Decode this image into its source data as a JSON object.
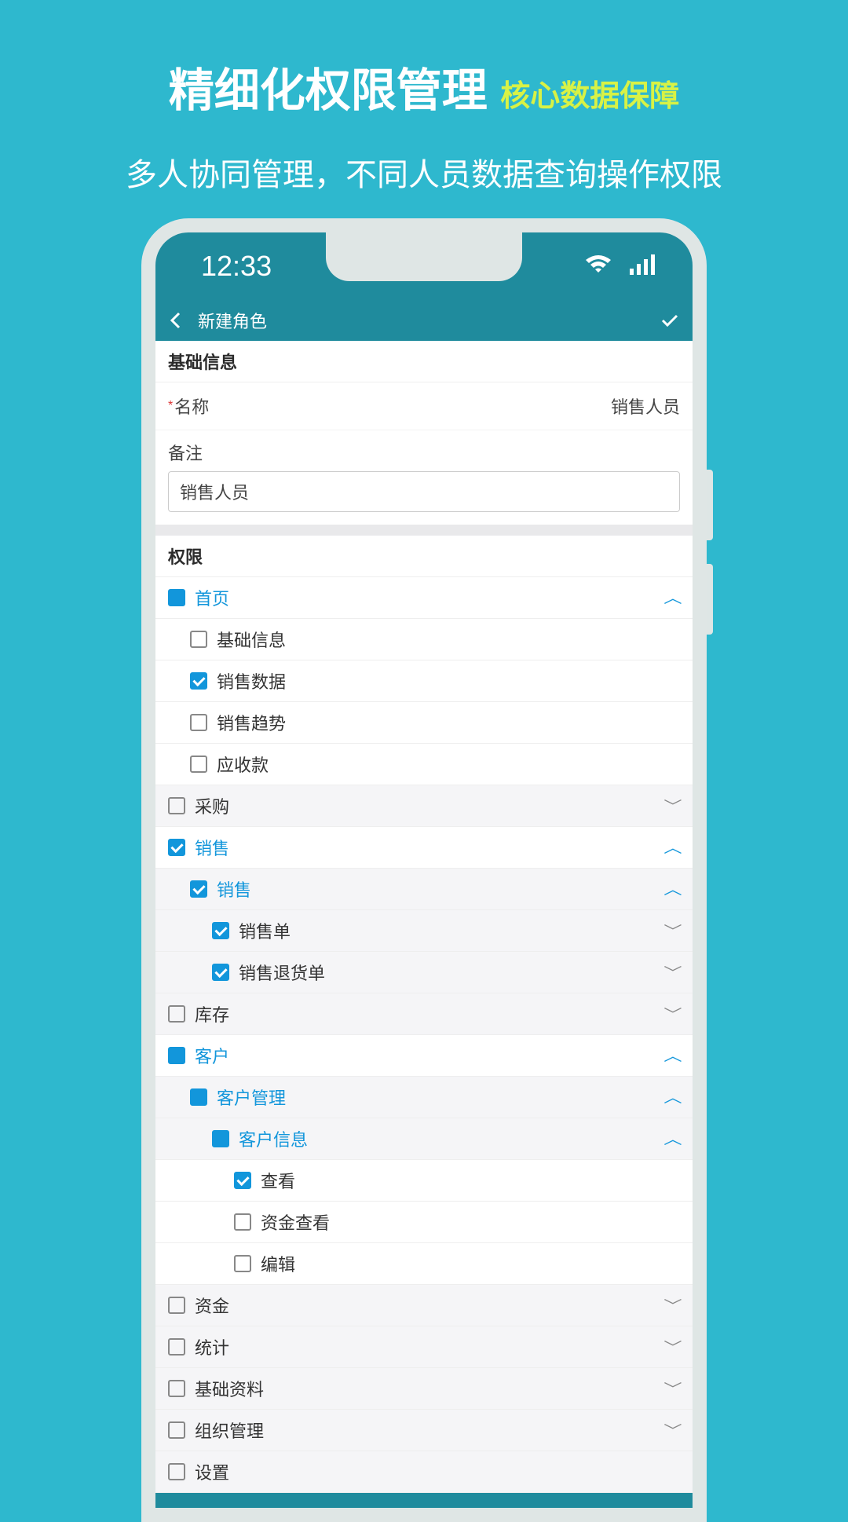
{
  "promo": {
    "title": "精细化权限管理",
    "subtitle": "核心数据保障",
    "description": "多人协同管理，不同人员数据查询操作权限"
  },
  "status": {
    "time": "12:33"
  },
  "nav": {
    "title": "新建角色"
  },
  "sections": {
    "basic": "基础信息",
    "permission": "权限"
  },
  "form": {
    "name_label": "名称",
    "name_value": "销售人员",
    "remark_label": "备注",
    "remark_value": "销售人员"
  },
  "permissions": [
    {
      "label": "首页",
      "state": "partial",
      "blue": true,
      "indent": 0,
      "expand": "up",
      "expandBlue": true
    },
    {
      "label": "基础信息",
      "state": "unchecked",
      "indent": 1
    },
    {
      "label": "销售数据",
      "state": "checked",
      "indent": 1
    },
    {
      "label": "销售趋势",
      "state": "unchecked",
      "indent": 1
    },
    {
      "label": "应收款",
      "state": "unchecked",
      "indent": 1
    },
    {
      "label": "采购",
      "state": "unchecked",
      "indent": 0,
      "expand": "down",
      "sub": true
    },
    {
      "label": "销售",
      "state": "checked",
      "blue": true,
      "indent": 0,
      "expand": "up",
      "expandBlue": true
    },
    {
      "label": "销售",
      "state": "checked",
      "blue": true,
      "indent": 1,
      "expand": "up",
      "expandBlue": true,
      "sub": true
    },
    {
      "label": "销售单",
      "state": "checked",
      "indent": 2,
      "expand": "down",
      "sub": true
    },
    {
      "label": "销售退货单",
      "state": "checked",
      "indent": 2,
      "expand": "down",
      "sub": true
    },
    {
      "label": "库存",
      "state": "unchecked",
      "indent": 0,
      "expand": "down",
      "sub": true
    },
    {
      "label": "客户",
      "state": "partial",
      "blue": true,
      "indent": 0,
      "expand": "up",
      "expandBlue": true
    },
    {
      "label": "客户管理",
      "state": "partial",
      "blue": true,
      "indent": 1,
      "expand": "up",
      "expandBlue": true,
      "sub": true
    },
    {
      "label": "客户信息",
      "state": "partial",
      "blue": true,
      "indent": 2,
      "expand": "up",
      "expandBlue": true,
      "sub": true
    },
    {
      "label": "查看",
      "state": "checked",
      "indent": 3
    },
    {
      "label": "资金查看",
      "state": "unchecked",
      "indent": 3
    },
    {
      "label": "编辑",
      "state": "unchecked",
      "indent": 3
    },
    {
      "label": "资金",
      "state": "unchecked",
      "indent": 0,
      "expand": "down",
      "sub": true
    },
    {
      "label": "统计",
      "state": "unchecked",
      "indent": 0,
      "expand": "down",
      "sub": true
    },
    {
      "label": "基础资料",
      "state": "unchecked",
      "indent": 0,
      "expand": "down",
      "sub": true
    },
    {
      "label": "组织管理",
      "state": "unchecked",
      "indent": 0,
      "expand": "down",
      "sub": true
    },
    {
      "label": "设置",
      "state": "unchecked",
      "indent": 0,
      "sub": true
    }
  ]
}
